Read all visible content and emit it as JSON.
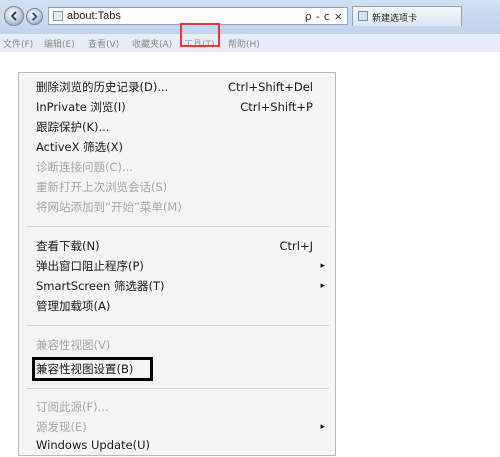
{
  "browser": {
    "address": "about:Tabs",
    "address_controls": [
      "ρ",
      "-",
      "c",
      "×"
    ],
    "tab_label": "新建选项卡"
  },
  "menubar": {
    "items": [
      "文件(F)",
      "编辑(E)",
      "查看(V)",
      "收藏夹(A)",
      "工具(T)",
      "帮助(H)"
    ]
  },
  "menu": {
    "items": [
      {
        "label": "删除浏览的历史记录(D)...",
        "shortcut": "Ctrl+Shift+Del"
      },
      {
        "label": "InPrivate 浏览(I)",
        "shortcut": "Ctrl+Shift+P"
      },
      {
        "label": "跟踪保护(K)..."
      },
      {
        "label": "ActiveX 筛选(X)"
      },
      {
        "label": "诊断连接问题(C)..."
      },
      {
        "label": "重新打开上次浏览会话(S)"
      },
      {
        "label": "将网站添加到“开始”菜单(M)"
      },
      {
        "label": "查看下载(N)",
        "shortcut": "Ctrl+J"
      },
      {
        "label": "弹出窗口阻止程序(P)",
        "arrow": "▸"
      },
      {
        "label": "SmartScreen 筛选器(T)",
        "arrow": "▸"
      },
      {
        "label": "管理加载项(A)"
      },
      {
        "label": "兼容性视图(V)"
      },
      {
        "label": "兼容性视图设置(B)"
      },
      {
        "label": "订阅此源(F)..."
      },
      {
        "label": "源发现(E)",
        "arrow": "▸"
      },
      {
        "label": "Windows Update(U)"
      }
    ]
  },
  "colors": {
    "menu_background": "#f4f4f4",
    "highlight_red": "#e23a3a",
    "highlight_black": "#000000",
    "disabled_text": "#a6a6a6"
  }
}
